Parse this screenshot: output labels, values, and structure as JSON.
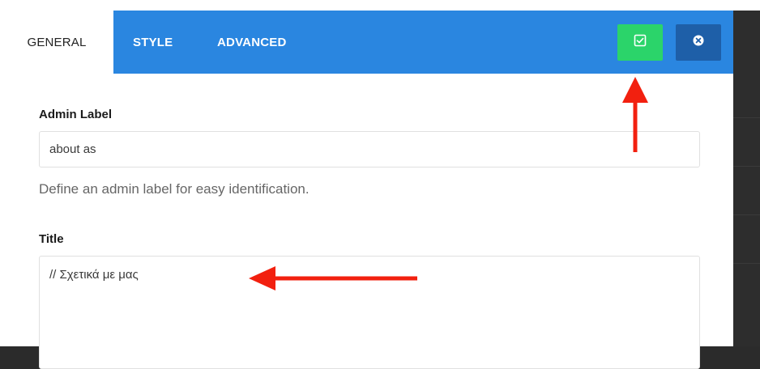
{
  "tabs": [
    {
      "label": "GENERAL",
      "active": true
    },
    {
      "label": "STYLE",
      "active": false
    },
    {
      "label": "ADVANCED",
      "active": false
    }
  ],
  "actions": {
    "save_icon": "check-square-icon",
    "close_icon": "close-circle-icon"
  },
  "form": {
    "admin_label": {
      "label": "Admin Label",
      "value": "about as",
      "help": "Define an admin label for easy identification."
    },
    "title": {
      "label": "Title",
      "value": "// Σχετικά με μας"
    }
  },
  "colors": {
    "tab_bar": "#2a86e0",
    "save_button": "#2bd46a",
    "close_button": "#1e5fa8",
    "annotation_arrow": "#f2200f"
  }
}
